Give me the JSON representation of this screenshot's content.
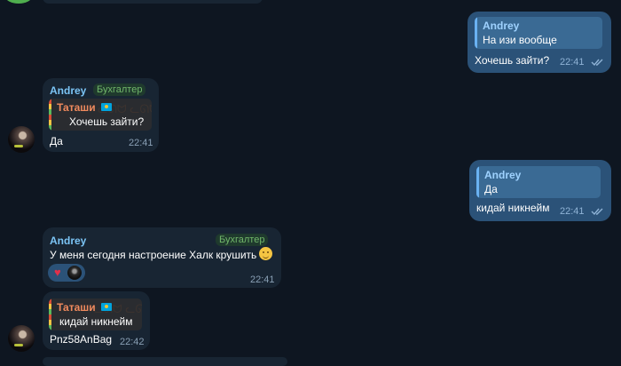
{
  "messages": [
    {
      "id": "out1",
      "reply": {
        "author": "Andrey",
        "text": "На изи вообще"
      },
      "text": "Хочешь зайти?",
      "time": "22:41"
    },
    {
      "id": "in1",
      "sender": "Andrey",
      "badge": "Бухгалтер",
      "reply": {
        "author": "Таташи",
        "text": "Хочешь зайти?"
      },
      "text": "Да",
      "time": "22:41"
    },
    {
      "id": "out2",
      "reply": {
        "author": "Andrey",
        "text": "Да"
      },
      "text": "кидай никнейм",
      "time": "22:41"
    },
    {
      "id": "in2",
      "sender": "Andrey",
      "badge": "Бухгалтер",
      "text": "У меня сегодня настроение Халк крушить",
      "time": "22:41",
      "reactions": [
        "heart",
        "avatar"
      ]
    },
    {
      "id": "in3",
      "reply": {
        "author": "Таташи",
        "text": "кидай никнейм"
      },
      "text": "Pnz58AnBag",
      "time": "22:42"
    }
  ],
  "icons": {
    "read_checks": "double-check-icon",
    "reaction_heart": "heart-icon",
    "emoji_grin": "grinning-emoji-icon",
    "flag": "kazakhstan-flag-icon",
    "cats": "cat-pattern-icon"
  },
  "colors": {
    "background": "#0e1621",
    "incoming_bubble": "#182533",
    "outgoing_bubble": "#2b5278",
    "name": "#7bc4f5",
    "badge": "#71b66a",
    "reply_author_tatashi": "#f08a5d"
  }
}
